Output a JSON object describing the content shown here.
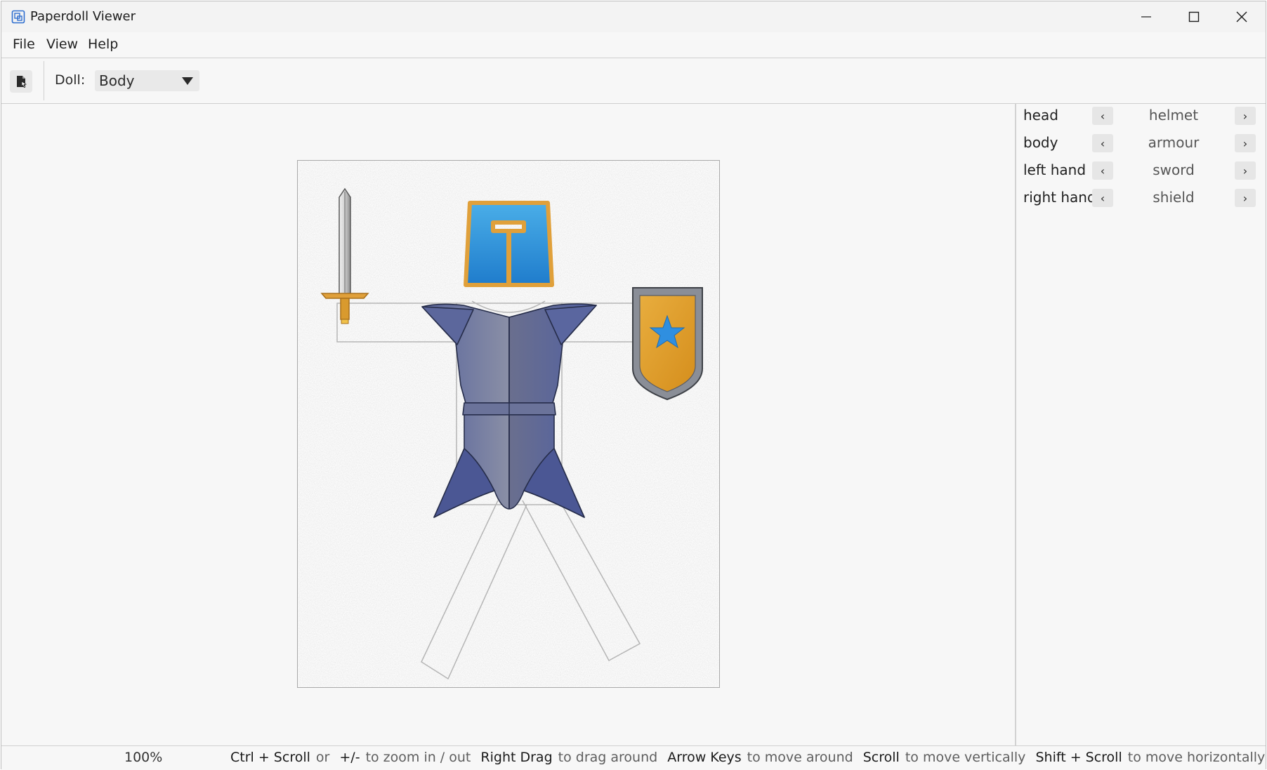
{
  "window": {
    "title": "Paperdoll Viewer"
  },
  "menu": {
    "file": "File",
    "view": "View",
    "help": "Help"
  },
  "toolbar": {
    "doll_label": "Doll:",
    "doll_value": "Body"
  },
  "slots": [
    {
      "label": "head",
      "value": "helmet"
    },
    {
      "label": "body",
      "value": "armour"
    },
    {
      "label": "left hand",
      "value": "sword"
    },
    {
      "label": "right hand",
      "value": "shield"
    }
  ],
  "slot_buttons": {
    "prev": "‹",
    "next": "›"
  },
  "status": {
    "zoom": "100%",
    "hints": [
      {
        "key": "Ctrl + Scroll",
        "desc": "or"
      },
      {
        "key": "+/-",
        "desc": "to zoom in / out"
      },
      {
        "key": "Right Drag",
        "desc": "to drag around"
      },
      {
        "key": "Arrow Keys",
        "desc": "to move around"
      },
      {
        "key": "Scroll",
        "desc": "to move vertically"
      },
      {
        "key": "Shift + Scroll",
        "desc": "to move horizontally"
      }
    ]
  },
  "colors": {
    "armour": "#4f5b94",
    "helmet": "#2f8fd6",
    "trim": "#e0a03a",
    "shield": "#dc972b",
    "star": "#2f8fe0"
  }
}
